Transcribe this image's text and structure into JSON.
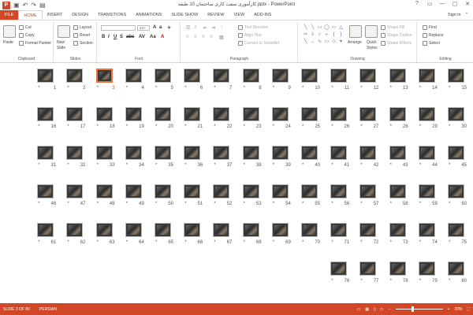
{
  "window": {
    "title": "کارآموزی سفت کاری ساختمان 10 طبقه.pptx - PowerPoint",
    "app_icon_letter": "P",
    "qat_icons": [
      "save-icon",
      "undo-icon",
      "redo-icon",
      "start-slideshow-icon"
    ],
    "controls": [
      "?",
      "▭",
      "—",
      "▢",
      "✕"
    ]
  },
  "tabs": {
    "items": [
      {
        "label": "FILE",
        "kind": "file"
      },
      {
        "label": "HOME",
        "kind": "active"
      },
      {
        "label": "INSERT",
        "kind": ""
      },
      {
        "label": "DESIGN",
        "kind": ""
      },
      {
        "label": "TRANSITIONS",
        "kind": ""
      },
      {
        "label": "ANIMATIONS",
        "kind": ""
      },
      {
        "label": "SLIDE SHOW",
        "kind": ""
      },
      {
        "label": "REVIEW",
        "kind": ""
      },
      {
        "label": "VIEW",
        "kind": ""
      },
      {
        "label": "ADD-INS",
        "kind": ""
      }
    ],
    "sign_in": "Sign in"
  },
  "ribbon": {
    "clipboard": {
      "label": "Clipboard",
      "paste": "Paste",
      "cut": "Cut",
      "copy": "Copy",
      "format_painter": "Format Painter"
    },
    "slides": {
      "label": "Slides",
      "new_slide": "New",
      "new_slide2": "Slide",
      "layout": "Layout",
      "reset": "Reset",
      "section": "Section"
    },
    "font": {
      "label": "Font",
      "font_name": "",
      "font_size": "43+"
    },
    "paragraph": {
      "label": "Paragraph",
      "text_direction": "Text Direction",
      "align_text": "Align Text",
      "convert_smartart": "Convert to SmartArt"
    },
    "drawing": {
      "label": "Drawing",
      "arrange": "Arrange",
      "quick_styles": "Quick",
      "quick_styles2": "Styles",
      "shape_fill": "Shape Fill",
      "shape_outline": "Shape Outline",
      "shape_effects": "Shape Effects"
    },
    "editing": {
      "label": "Editing",
      "find": "Find",
      "replace": "Replace",
      "select": "Select"
    }
  },
  "sorter": {
    "slides": [
      15,
      14,
      13,
      12,
      11,
      10,
      9,
      8,
      7,
      6,
      5,
      4,
      3,
      2,
      1,
      30,
      29,
      28,
      27,
      26,
      25,
      24,
      23,
      22,
      21,
      20,
      19,
      18,
      17,
      16,
      45,
      44,
      43,
      42,
      41,
      40,
      39,
      38,
      37,
      36,
      35,
      34,
      33,
      32,
      31,
      60,
      59,
      58,
      57,
      56,
      55,
      54,
      53,
      52,
      51,
      50,
      49,
      48,
      47,
      46,
      75,
      74,
      73,
      72,
      71,
      70,
      69,
      68,
      67,
      66,
      65,
      64,
      63,
      62,
      61,
      80,
      79,
      78,
      77,
      76
    ],
    "selected_slide": 3,
    "star": "*"
  },
  "status": {
    "slide_of": "SLIDE 3 OF 80",
    "language": "PERSIAN",
    "zoom": "20%",
    "zoom_minus": "−",
    "zoom_plus": "+"
  },
  "colors": {
    "accent": "#d24726",
    "selection": "#e8743b"
  }
}
